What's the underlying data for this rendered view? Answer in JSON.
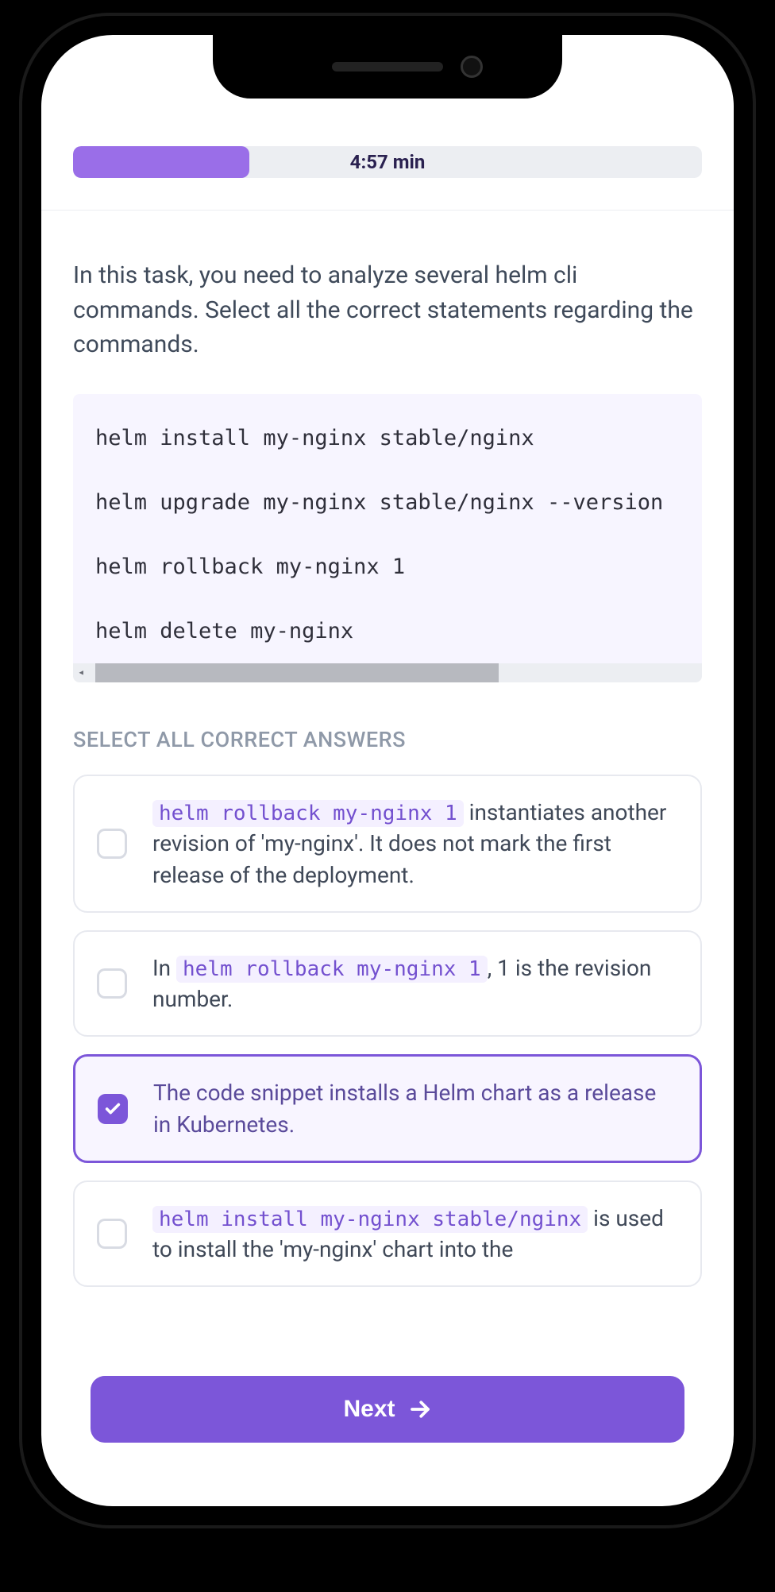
{
  "progress": {
    "percent": 28,
    "timer_label": "4:57 min"
  },
  "question": {
    "prompt": "In this task, you need to analyze several helm cli commands. Select all the correct statements regarding the commands.",
    "code": "helm install my-nginx stable/nginx\n\nhelm upgrade my-nginx stable/nginx --version\n\nhelm rollback my-nginx 1\n\nhelm delete my-nginx"
  },
  "section_label": "SELECT ALL CORRECT ANSWERS",
  "answers": [
    {
      "code": "helm rollback my-nginx 1",
      "text_before": "",
      "text_after": " instantiates another revision of 'my-nginx'. It does not mark the first release of the deployment.",
      "selected": false
    },
    {
      "code": "helm rollback my-nginx 1",
      "text_before": "In ",
      "text_after": ", 1 is the revision number.",
      "selected": false
    },
    {
      "code": "",
      "text_before": "The code snippet installs a Helm chart as a release in Kubernetes.",
      "text_after": "",
      "selected": true
    },
    {
      "code": "helm install my-nginx stable/nginx",
      "text_before": "",
      "text_after": " is used to install the 'my-nginx' chart into the",
      "selected": false
    }
  ],
  "next_label": "Next"
}
